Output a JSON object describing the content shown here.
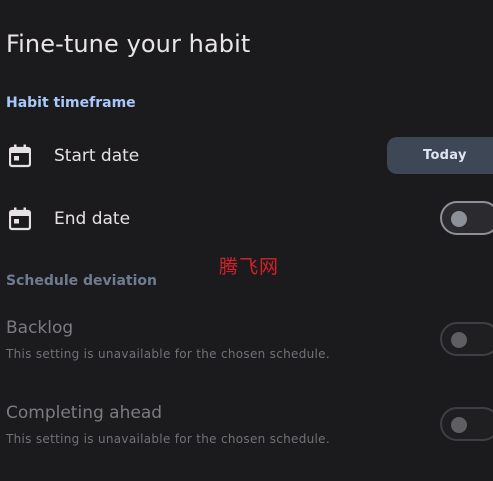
{
  "page": {
    "title": "Fine-tune your habit"
  },
  "habit_timeframe": {
    "heading": "Habit timeframe",
    "start_date": {
      "label": "Start date",
      "icon": "calendar-icon",
      "button_label": "Today"
    },
    "end_date": {
      "label": "End date",
      "icon": "calendar-icon",
      "toggle_on": false
    }
  },
  "schedule_deviation": {
    "heading": "Schedule deviation",
    "backlog": {
      "label": "Backlog",
      "description": "This setting is unavailable for the chosen schedule.",
      "toggle_on": false,
      "enabled": false
    },
    "completing_ahead": {
      "label": "Completing ahead",
      "description": "This setting is unavailable for the chosen schedule.",
      "toggle_on": false,
      "enabled": false
    }
  },
  "watermark": {
    "text": "腾飞网"
  },
  "colors": {
    "background": "#1b1b1d",
    "accent_heading": "#a8c7fa",
    "muted_heading": "#6d7c93",
    "button_bg": "#3e4756",
    "watermark": "#d4202a"
  }
}
